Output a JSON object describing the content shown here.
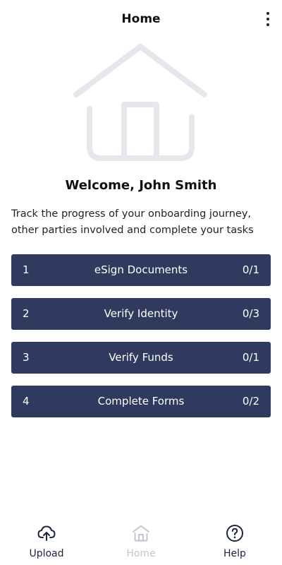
{
  "header": {
    "title": "Home",
    "menu_icon": "more-vertical-icon"
  },
  "hero": {
    "icon": "house-illustration-icon",
    "color": "#e6e7ed"
  },
  "welcome": {
    "text": "Welcome, John Smith"
  },
  "description": {
    "text": "Track the progress of your onboarding journey, other parties involved and complete your tasks"
  },
  "tasks": [
    {
      "number": "1",
      "label": "eSign Documents",
      "progress": "0/1"
    },
    {
      "number": "2",
      "label": "Verify Identity",
      "progress": "0/3"
    },
    {
      "number": "3",
      "label": "Verify Funds",
      "progress": "0/1"
    },
    {
      "number": "4",
      "label": "Complete Forms",
      "progress": "0/2"
    }
  ],
  "task_color": "#2f3a5e",
  "bottom_nav": {
    "items": [
      {
        "label": "Upload",
        "icon": "cloud-upload-icon",
        "active": true
      },
      {
        "label": "Home",
        "icon": "home-icon",
        "active": false
      },
      {
        "label": "Help",
        "icon": "help-circle-icon",
        "active": true
      }
    ]
  }
}
